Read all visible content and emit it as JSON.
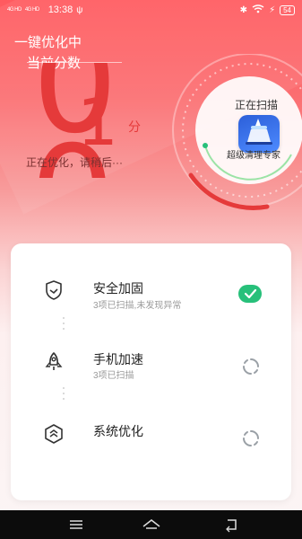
{
  "status_bar": {
    "signal1": "4G HD",
    "signal2": "4G HD",
    "time": "13:38",
    "battery": "54"
  },
  "header": {
    "title_line1": "一键优化中",
    "title_line2": "当前分数"
  },
  "score": {
    "digit_top": "0",
    "digit_main": "1",
    "digit_bottom": "0",
    "unit": "分",
    "status": "正在优化，请稍后···"
  },
  "scan": {
    "label": "正在扫描",
    "app_name": "超级清理专家",
    "app_icon": "cleaner-app-icon"
  },
  "tasks": [
    {
      "title": "安全加固",
      "subtitle": "3项已扫描,未发现异常",
      "icon": "shield-icon",
      "state": "done"
    },
    {
      "title": "手机加速",
      "subtitle": "3项已扫描",
      "icon": "rocket-icon",
      "state": "loading"
    },
    {
      "title": "系统优化",
      "subtitle": "",
      "icon": "optimize-icon",
      "state": "loading"
    }
  ],
  "colors": {
    "accent": "#e53a3a",
    "success": "#27c07a",
    "gauge_green": "#9be3a6"
  }
}
